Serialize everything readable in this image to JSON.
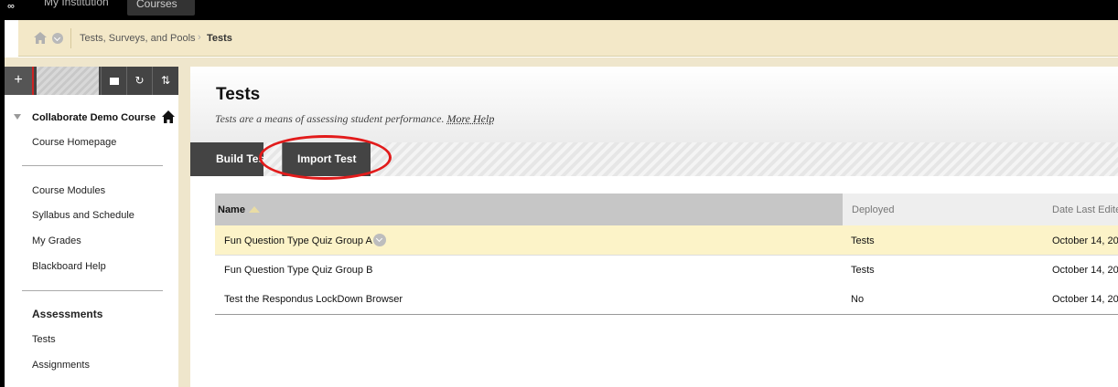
{
  "topnav": {
    "tabs": [
      {
        "label": "My Institution"
      },
      {
        "label": "Courses"
      }
    ]
  },
  "breadcrumb": {
    "items": [
      "Tests, Surveys, and Pools",
      "Tests"
    ]
  },
  "sidebar": {
    "course_title": "Collaborate Demo Course",
    "links_group1": [
      "Course Homepage"
    ],
    "links_group2": [
      "Course Modules",
      "Syllabus and Schedule",
      "My Grades",
      "Blackboard Help"
    ],
    "section_heading": "Assessments",
    "links_group3": [
      "Tests",
      "Assignments"
    ]
  },
  "page": {
    "title": "Tests",
    "subtitle": "Tests are a means of assessing student performance.",
    "more_help": "More Help"
  },
  "actions": {
    "build": "Build Test",
    "import": "Import Test"
  },
  "table": {
    "columns": [
      "Name",
      "Deployed",
      "Date Last Edited"
    ],
    "rows": [
      {
        "name": "Fun Question Type Quiz Group A",
        "deployed": "Tests",
        "date": "October 14, 20"
      },
      {
        "name": "Fun Question Type Quiz Group B",
        "deployed": "Tests",
        "date": "October 14, 20"
      },
      {
        "name": "Test the Respondus LockDown Browser",
        "deployed": "No",
        "date": "October 14, 20"
      }
    ]
  },
  "colors": {
    "accent_red": "#e21b1b",
    "crumb_bg": "#f3e8c8",
    "highlight_row": "#fcf3c8",
    "toolbar_dark": "#444444"
  }
}
